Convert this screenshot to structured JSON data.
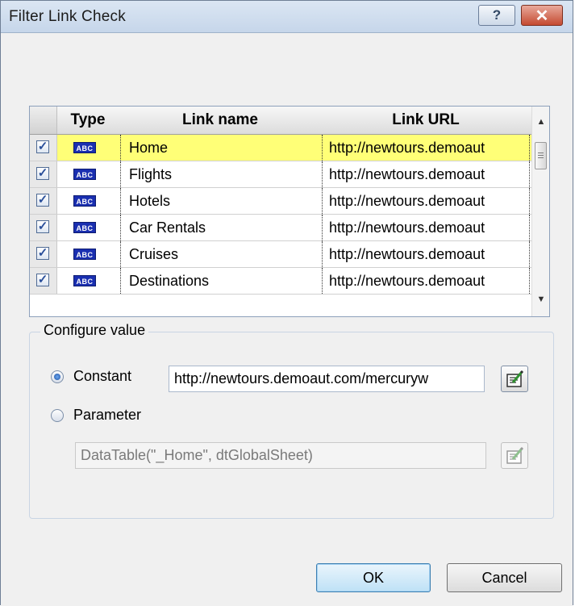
{
  "window": {
    "title": "Filter Link Check",
    "help_label": "?",
    "close_label": "✕"
  },
  "grid": {
    "columns": [
      "",
      "Type",
      "Link name",
      "Link URL"
    ],
    "rows": [
      {
        "checked": true,
        "type": "ABC",
        "name": "Home",
        "url": "http://newtours.demoaut",
        "selected": true
      },
      {
        "checked": true,
        "type": "ABC",
        "name": "Flights",
        "url": "http://newtours.demoaut",
        "selected": false
      },
      {
        "checked": true,
        "type": "ABC",
        "name": "Hotels",
        "url": "http://newtours.demoaut",
        "selected": false
      },
      {
        "checked": true,
        "type": "ABC",
        "name": "Car Rentals",
        "url": "http://newtours.demoaut",
        "selected": false
      },
      {
        "checked": true,
        "type": "ABC",
        "name": "Cruises",
        "url": "http://newtours.demoaut",
        "selected": false
      },
      {
        "checked": true,
        "type": "ABC",
        "name": "Destinations",
        "url": "http://newtours.demoaut",
        "selected": false
      }
    ],
    "check_glyph": "✓"
  },
  "configure": {
    "group_label": "Configure value",
    "constant_label": "Constant",
    "constant_selected": true,
    "constant_value": "http://newtours.demoaut.com/mercuryw",
    "parameter_label": "Parameter",
    "parameter_selected": false,
    "parameter_value": "DataTable(\"_Home\", dtGlobalSheet)"
  },
  "buttons": {
    "ok": "OK",
    "cancel": "Cancel"
  },
  "icons": {
    "abc": "abc-type-icon",
    "edit": "edit-value-icon",
    "checkbox": "checkbox-checked-icon",
    "scroll_up": "scroll-up-arrow-icon",
    "scroll_down": "scroll-down-arrow-icon"
  },
  "colors": {
    "selected_row": "#ffff77",
    "abc_icon_bg": "#1a2fb0",
    "close_button": "#c44a31"
  }
}
